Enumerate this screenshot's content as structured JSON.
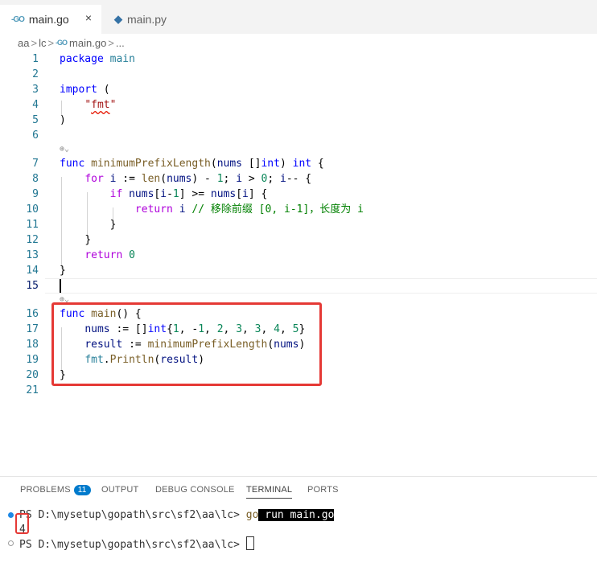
{
  "tabs": [
    {
      "label": "main.go",
      "icon": "go-file-icon",
      "active": true,
      "close": "×"
    },
    {
      "label": "main.py",
      "icon": "python-file-icon",
      "active": false
    }
  ],
  "icons": {
    "go": "-GO",
    "py": "◆"
  },
  "breadcrumb": {
    "seg1": "aa",
    "seg2": "lc",
    "file": "main.go",
    "more": "...",
    "sep": ">"
  },
  "codelens": "⊕⌄",
  "lines": [
    "1",
    "2",
    "3",
    "4",
    "5",
    "6",
    "7",
    "8",
    "9",
    "10",
    "11",
    "12",
    "13",
    "14",
    "15",
    "16",
    "17",
    "18",
    "19",
    "20",
    "21"
  ],
  "code": {
    "l1": [
      "package",
      " ",
      "main"
    ],
    "l3": [
      "import",
      " ("
    ],
    "l4": [
      "\"",
      "fmt",
      "\""
    ],
    "l5": [
      ")"
    ],
    "l7": [
      "func",
      " ",
      "minimumPrefixLength",
      "(",
      "nums",
      " []",
      "int",
      ") ",
      "int",
      " {"
    ],
    "l8": [
      "for",
      " ",
      "i",
      " := ",
      "len",
      "(",
      "nums",
      ") - ",
      "1",
      "; ",
      "i",
      " > ",
      "0",
      "; ",
      "i",
      "-- {"
    ],
    "l9": [
      "if",
      " ",
      "nums",
      "[",
      "i",
      "-",
      "1",
      "] >= ",
      "nums",
      "[",
      "i",
      "] {"
    ],
    "l10": [
      "return",
      " ",
      "i",
      " ",
      "// 移除前缀 [0, i-1]，长度为 i"
    ],
    "l11": [
      "}"
    ],
    "l12": [
      "}"
    ],
    "l13": [
      "return",
      " ",
      "0"
    ],
    "l14": [
      "}"
    ],
    "l16": [
      "func",
      " ",
      "main",
      "() {"
    ],
    "l17": [
      "nums",
      " := []",
      "int",
      "{",
      "1",
      ", -",
      "1",
      ", ",
      "2",
      ", ",
      "3",
      ", ",
      "3",
      ", ",
      "4",
      ", ",
      "5",
      "}"
    ],
    "l18": [
      "result",
      " := ",
      "minimumPrefixLength",
      "(",
      "nums",
      ")"
    ],
    "l19": [
      "fmt",
      ".",
      "Println",
      "(",
      "result",
      ")"
    ],
    "l20": [
      "}"
    ]
  },
  "panel": {
    "tabs": [
      "PROBLEMS",
      "OUTPUT",
      "DEBUG CONSOLE",
      "TERMINAL",
      "PORTS"
    ],
    "problems_count": "11",
    "active_tab": "TERMINAL"
  },
  "terminal": {
    "prompt1": "PS D:\\mysetup\\gopath\\src\\sf2\\aa\\lc> ",
    "cmd_go": "go",
    "cmd_rest": " run main.go",
    "output": "4",
    "prompt2": "PS D:\\mysetup\\gopath\\src\\sf2\\aa\\lc> "
  },
  "colors": {
    "accent": "#007acc",
    "highlight_box": "#e53935",
    "dot_active": "#1e88e5",
    "dot_idle": "#9e9e9e"
  }
}
